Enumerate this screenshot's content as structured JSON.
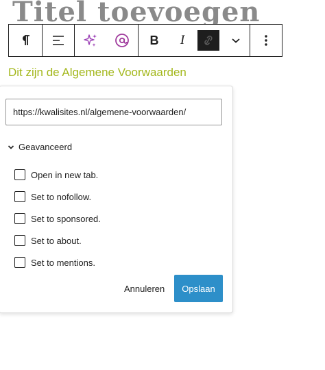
{
  "page": {
    "title": "Titel toevoegen"
  },
  "toolbar": {
    "icons": [
      "paragraph-icon",
      "align-icon",
      "sparkle-icon",
      "mention-icon",
      "bold-icon",
      "italic-icon",
      "unlink-icon",
      "chevron-down-icon",
      "more-options-icon"
    ],
    "bold_label": "B",
    "italic_label": "I",
    "colors": {
      "sparkle": "#9b3fb5",
      "mention": "#a03b9d",
      "active_bg": "#1e1e1e"
    }
  },
  "content": {
    "link_text": "Dit zijn de Algemene Voorwaarden",
    "link_color": "#a3b71b"
  },
  "link_popover": {
    "url_value": "https://kwalisites.nl/algemene-voorwaarden/",
    "advanced_label": "Geavanceerd",
    "options": [
      {
        "label": "Open in new tab.",
        "checked": false
      },
      {
        "label": "Set to nofollow.",
        "checked": false
      },
      {
        "label": "Set to sponsored.",
        "checked": false
      },
      {
        "label": "Set to about.",
        "checked": false
      },
      {
        "label": "Set to mentions.",
        "checked": false
      }
    ],
    "cancel_label": "Annuleren",
    "save_label": "Opslaan",
    "save_color": "#2d8fc9"
  }
}
